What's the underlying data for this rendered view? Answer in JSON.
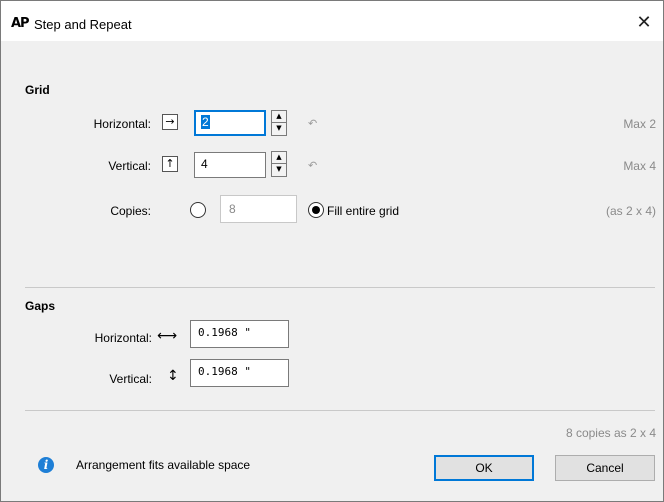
{
  "window": {
    "title": "Step and Repeat",
    "logo_text": "AP",
    "close_glyph": "✕"
  },
  "grid": {
    "section_title": "Grid",
    "horizontal": {
      "label": "Horizontal:",
      "icon": "arrow-right-icon",
      "glyph": "→",
      "value": "2",
      "max": "Max 2"
    },
    "vertical": {
      "label": "Vertical:",
      "icon": "arrow-up-icon",
      "glyph": "↑",
      "value": "4",
      "max": "Max 4"
    },
    "copies": {
      "label": "Copies:",
      "value": "8",
      "fill_label": "Fill entire grid",
      "hint": "(as 2 x 4)",
      "selected": "fill"
    }
  },
  "gaps": {
    "section_title": "Gaps",
    "horizontal": {
      "label": "Horizontal:",
      "icon": "horizontal-gap-icon",
      "glyph": "⟷",
      "value": "0.1968 \""
    },
    "vertical": {
      "label": "Vertical:",
      "icon": "vertical-gap-icon",
      "glyph": "↕",
      "value": "0.1968 \""
    }
  },
  "summary": "8 copies as 2 x 4",
  "status": {
    "icon": "info-icon",
    "text": "Arrangement fits available space"
  },
  "buttons": {
    "ok": "OK",
    "cancel": "Cancel"
  },
  "undo_glyph": "↶",
  "spin_up": "▲",
  "spin_down": "▼"
}
